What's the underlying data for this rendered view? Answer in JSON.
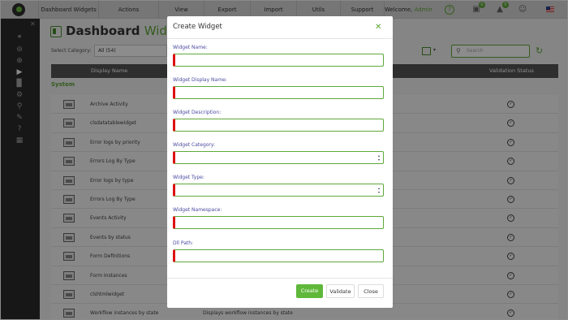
{
  "topbar": {
    "menu": [
      "Dashboard Widgets",
      "Actions",
      "View",
      "Export",
      "Import",
      "Utils",
      "Support"
    ],
    "welcome_prefix": "Welcome,",
    "username": "Admin",
    "badge_counts": [
      "0",
      "0"
    ]
  },
  "page": {
    "title_main": "Dashboard",
    "title_accent": "Widgets",
    "category_label": "Select Category:",
    "category_value": "All (54)",
    "search_placeholder": "Search",
    "columns": {
      "name": "Display Name",
      "status": "Validation Status"
    },
    "section": "System",
    "rows": [
      {
        "name": "Archive Activity",
        "desc": ""
      },
      {
        "name": "clsdatatablewidget",
        "desc": ""
      },
      {
        "name": "Error logs by priority",
        "desc": ""
      },
      {
        "name": "Errors Log By Type",
        "desc": ""
      },
      {
        "name": "Error logs by type",
        "desc": ""
      },
      {
        "name": "Errors Log By Type",
        "desc": ""
      },
      {
        "name": "Events Activity",
        "desc": ""
      },
      {
        "name": "Events by status",
        "desc": ""
      },
      {
        "name": "Form Definitions",
        "desc": ""
      },
      {
        "name": "Form Instances",
        "desc": ""
      },
      {
        "name": "clshtmlwidget",
        "desc": ""
      },
      {
        "name": "Workflow instances by state",
        "desc": "Displays workflow instances by state"
      }
    ]
  },
  "modal": {
    "title": "Create Widget",
    "fields": [
      {
        "label": "Widget Name:",
        "value": ""
      },
      {
        "label": "Widget Display Name:",
        "value": ""
      },
      {
        "label": "Widget Description:",
        "value": ""
      },
      {
        "label": "Widget Category:",
        "value": ""
      },
      {
        "label": "Widget Type:",
        "value": ""
      },
      {
        "label": "Widget Namespace:",
        "value": ""
      },
      {
        "label": "Dll Path:",
        "value": ""
      }
    ],
    "buttons": {
      "create": "Create",
      "validate": "Validate",
      "close": "Close"
    }
  },
  "colors": {
    "accent": "#5fa83a",
    "required": "#dd1111",
    "header": "#555555"
  }
}
